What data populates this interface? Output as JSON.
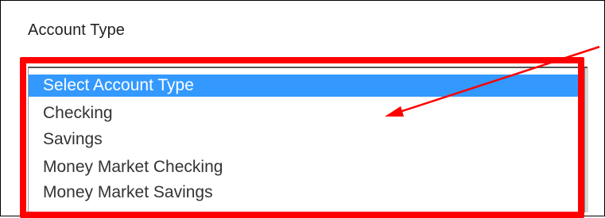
{
  "form": {
    "label": "Account Type"
  },
  "account_type_select": {
    "selected_index": 0,
    "options": [
      {
        "label": "Select Account Type"
      },
      {
        "label": "Checking"
      },
      {
        "label": "Savings"
      },
      {
        "label": "Money Market Checking"
      },
      {
        "label": "Money Market Savings"
      }
    ]
  },
  "annotation": {
    "highlight_color": "#ff0000",
    "arrow_color": "#ff0000",
    "selection_color": "#3399ff"
  }
}
